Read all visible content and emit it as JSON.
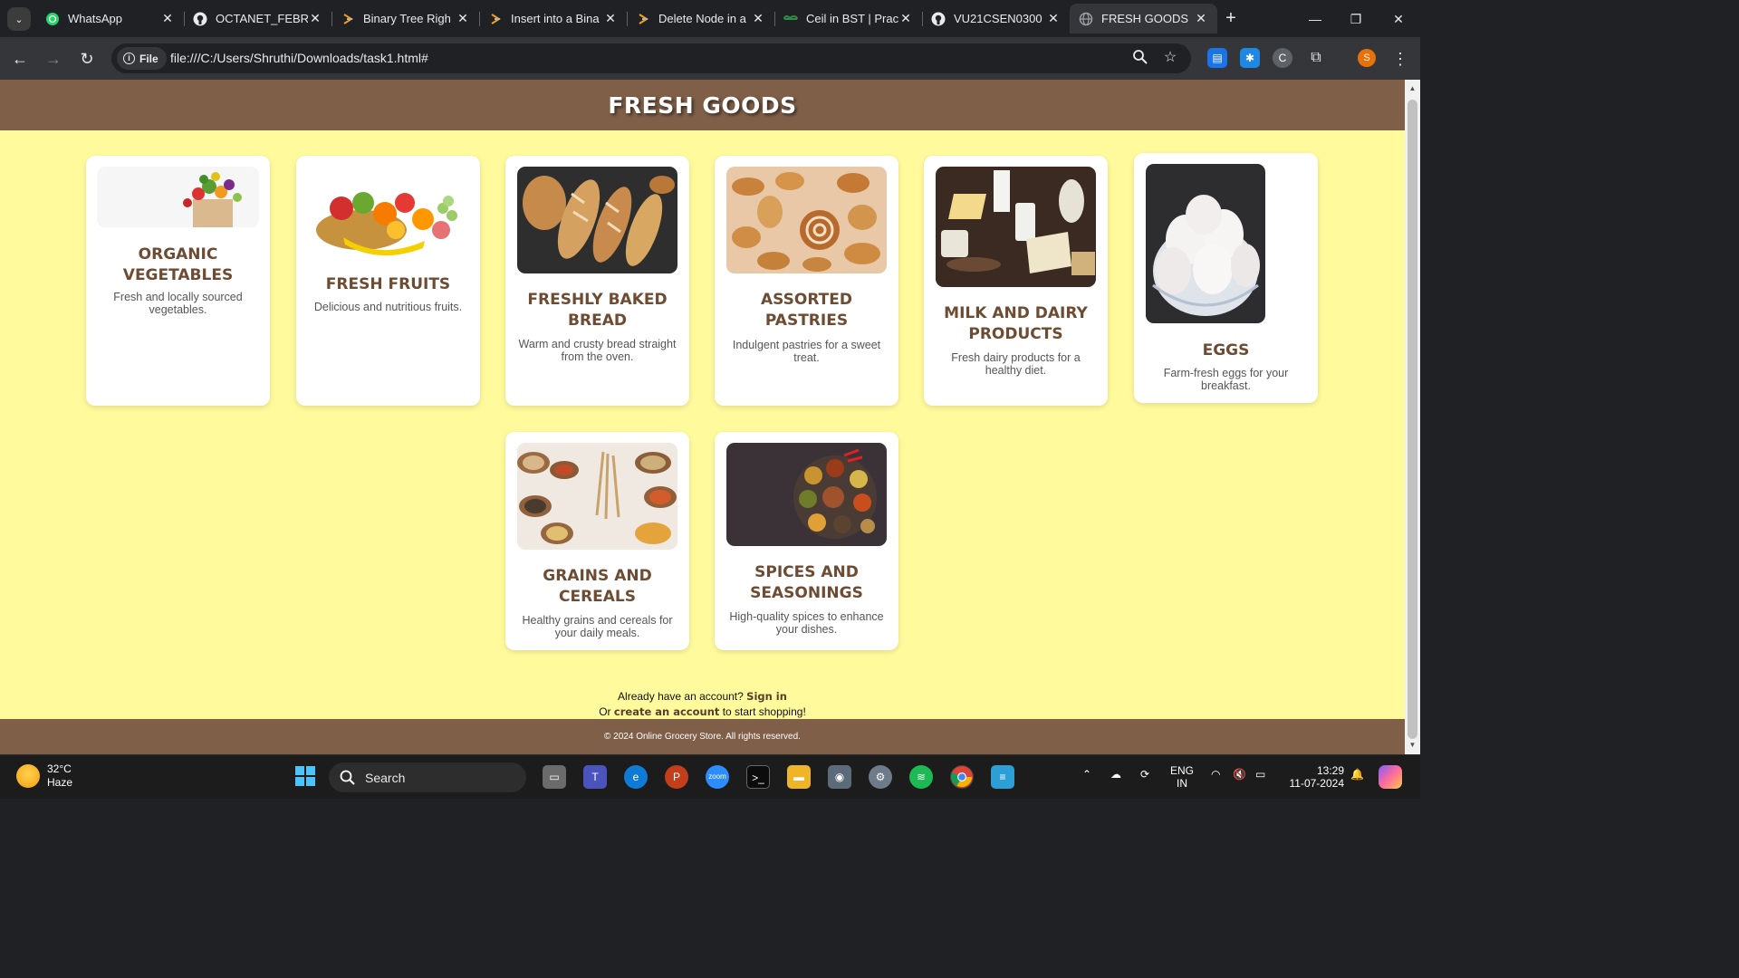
{
  "browser": {
    "tabs": [
      {
        "title": "WhatsApp",
        "icon": "whatsapp-icon",
        "active": false
      },
      {
        "title": "OCTANET_FEBRU",
        "icon": "github-icon",
        "active": false
      },
      {
        "title": "Binary Tree Righ",
        "icon": "coding-site-icon",
        "active": false
      },
      {
        "title": "Insert into a Bina",
        "icon": "coding-site-icon",
        "active": false
      },
      {
        "title": "Delete Node in a",
        "icon": "coding-site-icon",
        "active": false
      },
      {
        "title": "Ceil in BST | Prac",
        "icon": "gfg-icon",
        "active": false
      },
      {
        "title": "VU21CSEN0300",
        "icon": "github-icon",
        "active": false
      },
      {
        "title": "FRESH GOODS",
        "icon": "globe-icon",
        "active": true
      }
    ],
    "address": {
      "chip": "File",
      "url": "file:///C:/Users/Shruthi/Downloads/task1.html#"
    },
    "profile_initial": "S"
  },
  "page": {
    "title": "FRESH GOODS",
    "products": [
      {
        "name": "ORGANIC VEGETABLES",
        "description": "Fresh and locally sourced vegetables."
      },
      {
        "name": "FRESH FRUITS",
        "description": "Delicious and nutritious fruits."
      },
      {
        "name": "FRESHLY BAKED BREAD",
        "description": "Warm and crusty bread straight from the oven."
      },
      {
        "name": "ASSORTED PASTRIES",
        "description": "Indulgent pastries for a sweet treat."
      },
      {
        "name": "MILK AND DAIRY PRODUCTS",
        "description": "Fresh dairy products for a healthy diet."
      },
      {
        "name": "EGGS",
        "description": "Farm-fresh eggs for your breakfast."
      },
      {
        "name": "GRAINS AND CEREALS",
        "description": "Healthy grains and cereals for your daily meals."
      },
      {
        "name": "SPICES AND SEASONINGS",
        "description": "High-quality spices to enhance your dishes."
      }
    ],
    "account": {
      "line1_prefix": "Already have an account?",
      "sign_in": "Sign in",
      "line2_prefix": "Or",
      "create": "create an account",
      "line2_suffix": "to start shopping!"
    },
    "footer": "© 2024 Online Grocery Store. All rights reserved.",
    "colors": {
      "header": "#7f5f48",
      "background": "#fffa9b",
      "title_text": "#6d4c33"
    }
  },
  "taskbar": {
    "weather": {
      "temp": "32°C",
      "condition": "Haze"
    },
    "search_label": "Search",
    "language": {
      "line1": "ENG",
      "line2": "IN"
    },
    "clock": {
      "time": "13:29",
      "date": "11-07-2024"
    }
  }
}
